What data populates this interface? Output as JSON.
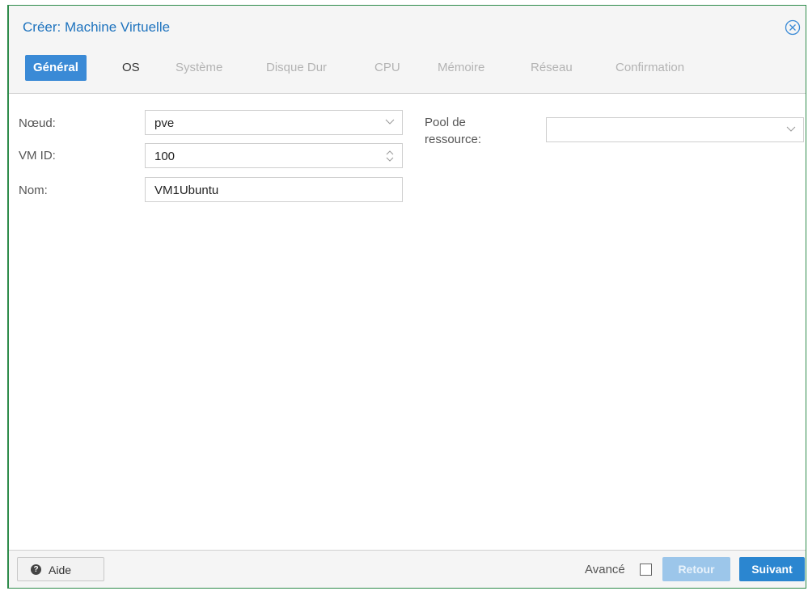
{
  "dialog": {
    "title": "Créer: Machine Virtuelle",
    "close_icon": "close-circle-icon"
  },
  "tabs": [
    {
      "label": "Général",
      "state": "active"
    },
    {
      "label": "OS",
      "state": "enabled"
    },
    {
      "label": "Système",
      "state": "disabled"
    },
    {
      "label": "Disque Dur",
      "state": "disabled"
    },
    {
      "label": "CPU",
      "state": "disabled"
    },
    {
      "label": "Mémoire",
      "state": "disabled"
    },
    {
      "label": "Réseau",
      "state": "disabled"
    },
    {
      "label": "Confirmation",
      "state": "disabled"
    }
  ],
  "form": {
    "node_label": "Nœud:",
    "node_value": "pve",
    "vmid_label": "VM ID:",
    "vmid_value": "100",
    "name_label": "Nom:",
    "name_value": "VM1Ubuntu",
    "pool_label_line1": "Pool de",
    "pool_label_line2": "ressource:",
    "pool_value": ""
  },
  "footer": {
    "help_label": "Aide",
    "help_icon": "question-circle-icon",
    "advanced_label": "Avancé",
    "advanced_checked": false,
    "back_label": "Retour",
    "next_label": "Suivant"
  },
  "colors": {
    "accent": "#2b86d0",
    "title": "#1e73be",
    "border": "#2e8b4a"
  }
}
